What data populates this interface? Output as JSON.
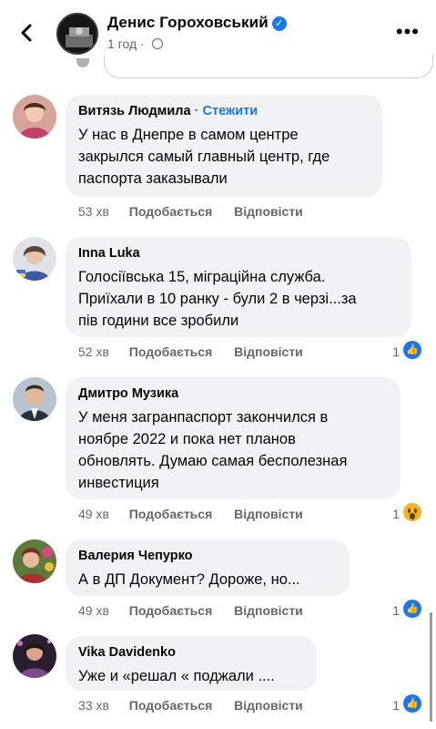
{
  "header": {
    "page_name": "Денис Гороховський",
    "time": "1 год",
    "more": "•••",
    "verified_icon": "verified-check-icon"
  },
  "comments": [
    {
      "author": "Витязь Людмила",
      "follow": "Стежити",
      "separator": "·",
      "text": "У нас в Днепре в самом центре\nзакрылся самый главный центр, где\nпаспорта заказывали",
      "time": "53 хв",
      "like": "Подобається",
      "reply": "Відповісти"
    },
    {
      "author": "Inna Luka",
      "text": "Голосіївська 15, міграційна служба.\nПриїхали в 10 ранку - були 2 в черзі...за\nпів години все зробили",
      "time": "52 хв",
      "like": "Подобається",
      "reply": "Відповісти",
      "reactions": "1",
      "reaction_icon": "like-icon"
    },
    {
      "author": "Дмитро Музика",
      "text": "У меня загранпаспорт закончился в\nноябре 2022 и пока нет планов\nобновлять. Думаю самая бесполезная\nинвестиция",
      "time": "49 хв",
      "like": "Подобається",
      "reply": "Відповісти",
      "reactions": "1",
      "reaction_icon": "wow-icon"
    },
    {
      "author": "Валерия Чепурко",
      "text": "А в ДП Документ? Дороже, но...",
      "time": "49 хв",
      "like": "Подобається",
      "reply": "Відповісти",
      "reactions": "1",
      "reaction_icon": "like-icon"
    },
    {
      "author": "Vika  Davidenko",
      "text": "Уже и «решал « поджали ....",
      "time": "33 хв",
      "like": "Подобається",
      "reply": "Відповісти",
      "reactions": "1",
      "reaction_icon": "like-icon"
    }
  ],
  "colors": {
    "accent": "#1877f2",
    "bubble": "#f0f2f5",
    "secondary_text": "#65676b"
  }
}
